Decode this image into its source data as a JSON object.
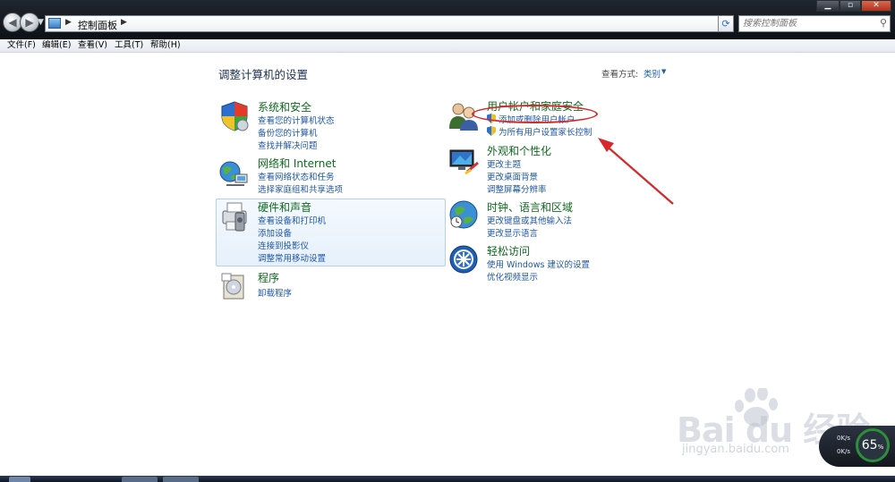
{
  "window": {
    "breadcrumb": "控制面板",
    "search_placeholder": "搜索控制面板"
  },
  "menubar": {
    "items": [
      "文件(F)",
      "编辑(E)",
      "查看(V)",
      "工具(T)",
      "帮助(H)"
    ]
  },
  "page": {
    "title": "调整计算机的设置",
    "view_by_label": "查看方式:",
    "view_by_value": "类别"
  },
  "categories": {
    "system": {
      "title": "系统和安全",
      "links": [
        "查看您的计算机状态",
        "备份您的计算机",
        "查找并解决问题"
      ]
    },
    "network": {
      "title": "网络和 Internet",
      "links": [
        "查看网络状态和任务",
        "选择家庭组和共享选项"
      ]
    },
    "hardware": {
      "title": "硬件和声音",
      "links": [
        "查看设备和打印机",
        "添加设备",
        "连接到投影仪",
        "调整常用移动设置"
      ]
    },
    "programs": {
      "title": "程序",
      "links": [
        "卸载程序"
      ]
    },
    "users": {
      "title": "用户帐户和家庭安全",
      "links": [
        "添加或删除用户帐户",
        "为所有用户设置家长控制"
      ]
    },
    "appearance": {
      "title": "外观和个性化",
      "links": [
        "更改主题",
        "更改桌面背景",
        "调整屏幕分辨率"
      ]
    },
    "clock": {
      "title": "时钟、语言和区域",
      "links": [
        "更改键盘或其他输入法",
        "更改显示语言"
      ]
    },
    "ease": {
      "title": "轻松访问",
      "links": [
        "使用 Windows 建议的设置",
        "优化视频显示"
      ]
    }
  },
  "watermark": {
    "brand": "Bai du 经验",
    "url": "jingyan.baidu.com"
  },
  "speed_widget": {
    "up": "0K/s",
    "down": "0K/s",
    "percent": "65",
    "percent_unit": "%"
  }
}
